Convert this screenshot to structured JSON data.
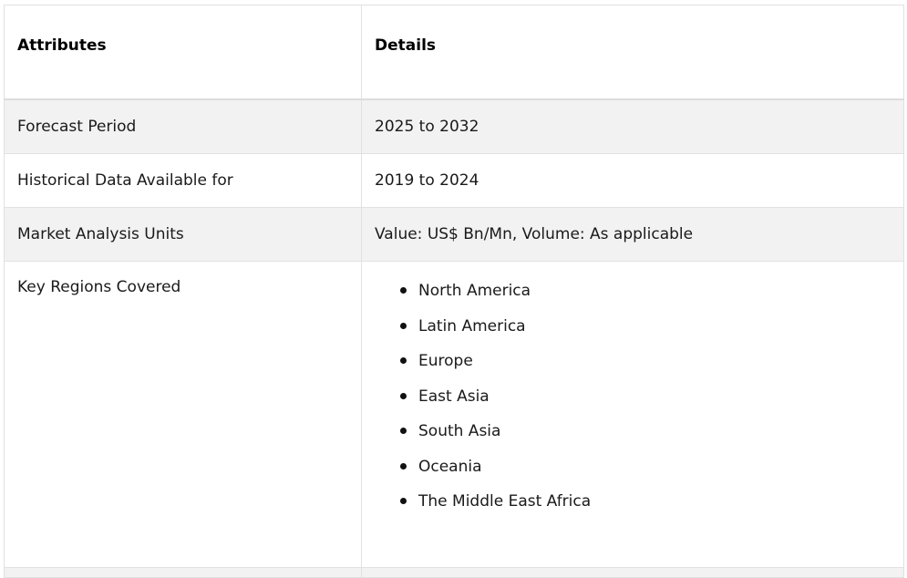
{
  "table": {
    "headers": [
      "Attributes",
      "Details"
    ],
    "rows": [
      {
        "attribute": "Forecast Period",
        "detail": "2025 to 2032"
      },
      {
        "attribute": "Historical Data Available for",
        "detail": "2019 to 2024"
      },
      {
        "attribute": "Market Analysis Units",
        "detail": "Value: US$ Bn/Mn, Volume: As applicable"
      }
    ],
    "regions": {
      "attribute": "Key Regions Covered",
      "items": [
        "North America",
        "Latin America",
        "Europe",
        "East Asia",
        "South Asia",
        "Oceania",
        "The Middle East Africa"
      ]
    }
  },
  "colors": {
    "row_shade": "#f2f2f2",
    "border": "#e1e1e1",
    "text": "#1a1a1a"
  }
}
